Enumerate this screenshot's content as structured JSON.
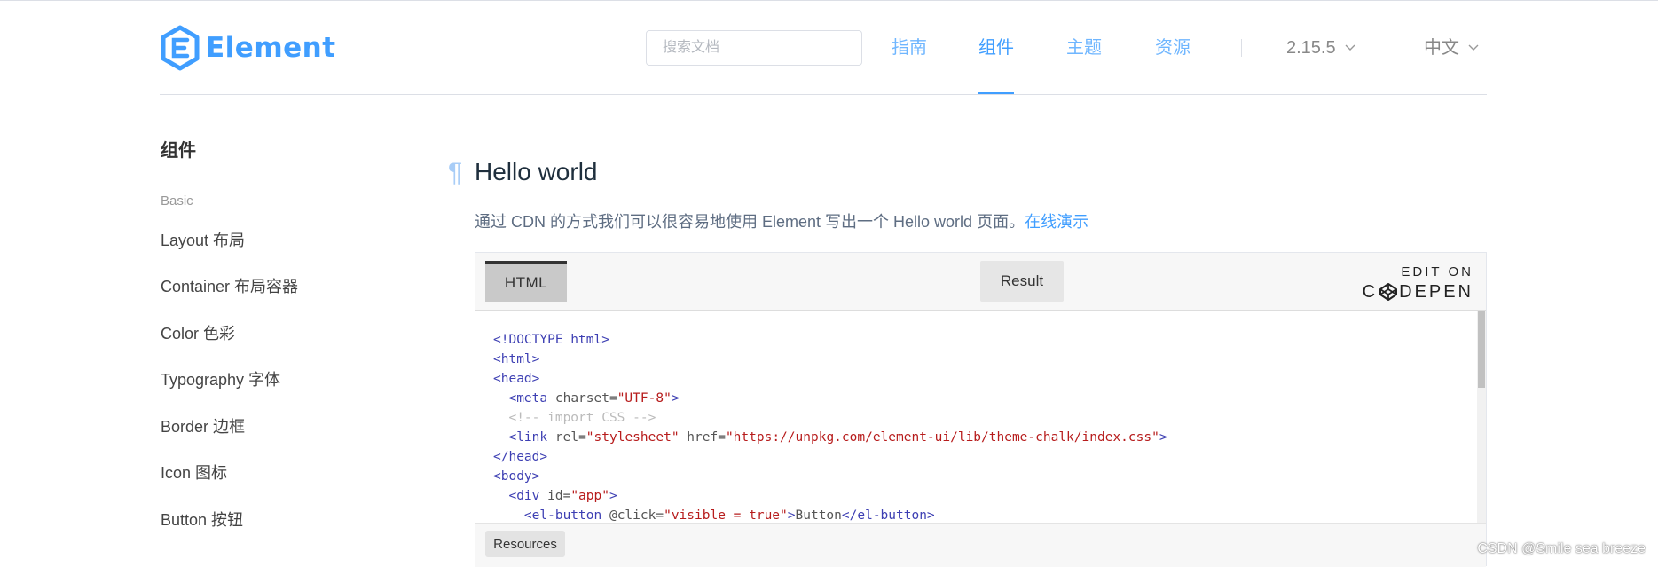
{
  "header": {
    "logo_text": "Element",
    "search_placeholder": "搜索文档",
    "nav": [
      {
        "label": "指南",
        "active": false
      },
      {
        "label": "组件",
        "active": true
      },
      {
        "label": "主题",
        "active": false
      },
      {
        "label": "资源",
        "active": false
      }
    ],
    "version": "2.15.5",
    "language": "中文"
  },
  "sidebar": {
    "title": "组件",
    "group": "Basic",
    "items": [
      {
        "label": "Layout 布局"
      },
      {
        "label": "Container 布局容器"
      },
      {
        "label": "Color 色彩"
      },
      {
        "label": "Typography 字体"
      },
      {
        "label": "Border 边框"
      },
      {
        "label": "Icon 图标"
      },
      {
        "label": "Button 按钮"
      }
    ]
  },
  "main": {
    "anchor": "¶",
    "heading": "Hello world",
    "desc": "通过 CDN 的方式我们可以很容易地使用 Element 写出一个 Hello world 页面。",
    "demo_link": "在线演示"
  },
  "codepen": {
    "tab_html": "HTML",
    "tab_result": "Result",
    "edit_on": "EDIT ON",
    "brand_start": "C",
    "brand_end": "DEPEN",
    "resources": "Resources",
    "code": {
      "doctype": "<!DOCTYPE html>",
      "html_open": "<html>",
      "head_open": "<head>",
      "meta_tag": "<meta",
      "meta_attr": "charset",
      "meta_val": "\"UTF-8\"",
      "tag_end": ">",
      "eq": "=",
      "comment": "<!-- import CSS -->",
      "link_tag": "<link",
      "rel_attr": "rel",
      "rel_val": "\"stylesheet\"",
      "href_attr": "href",
      "href_val": "\"https://unpkg.com/element-ui/lib/theme-chalk/index.css\"",
      "head_close": "</head>",
      "body_open": "<body>",
      "div_tag": "<div",
      "id_attr": "id",
      "id_val": "\"app\"",
      "btn_tag": "<el-button",
      "click_attr": "@click",
      "click_val": "\"visible = true\"",
      "btn_text": "Button",
      "btn_close": "</el-button>"
    }
  },
  "watermark": "CSDN @Smile sea breeze",
  "colors": {
    "brand": "#409eff",
    "text_primary": "#1f2f3d",
    "text_secondary": "#5e6d82",
    "border": "#dcdfe6"
  },
  "icons": {
    "logo": "element-logo-icon",
    "dropdown": "chevron-down-icon",
    "codepen": "codepen-cube-icon"
  }
}
